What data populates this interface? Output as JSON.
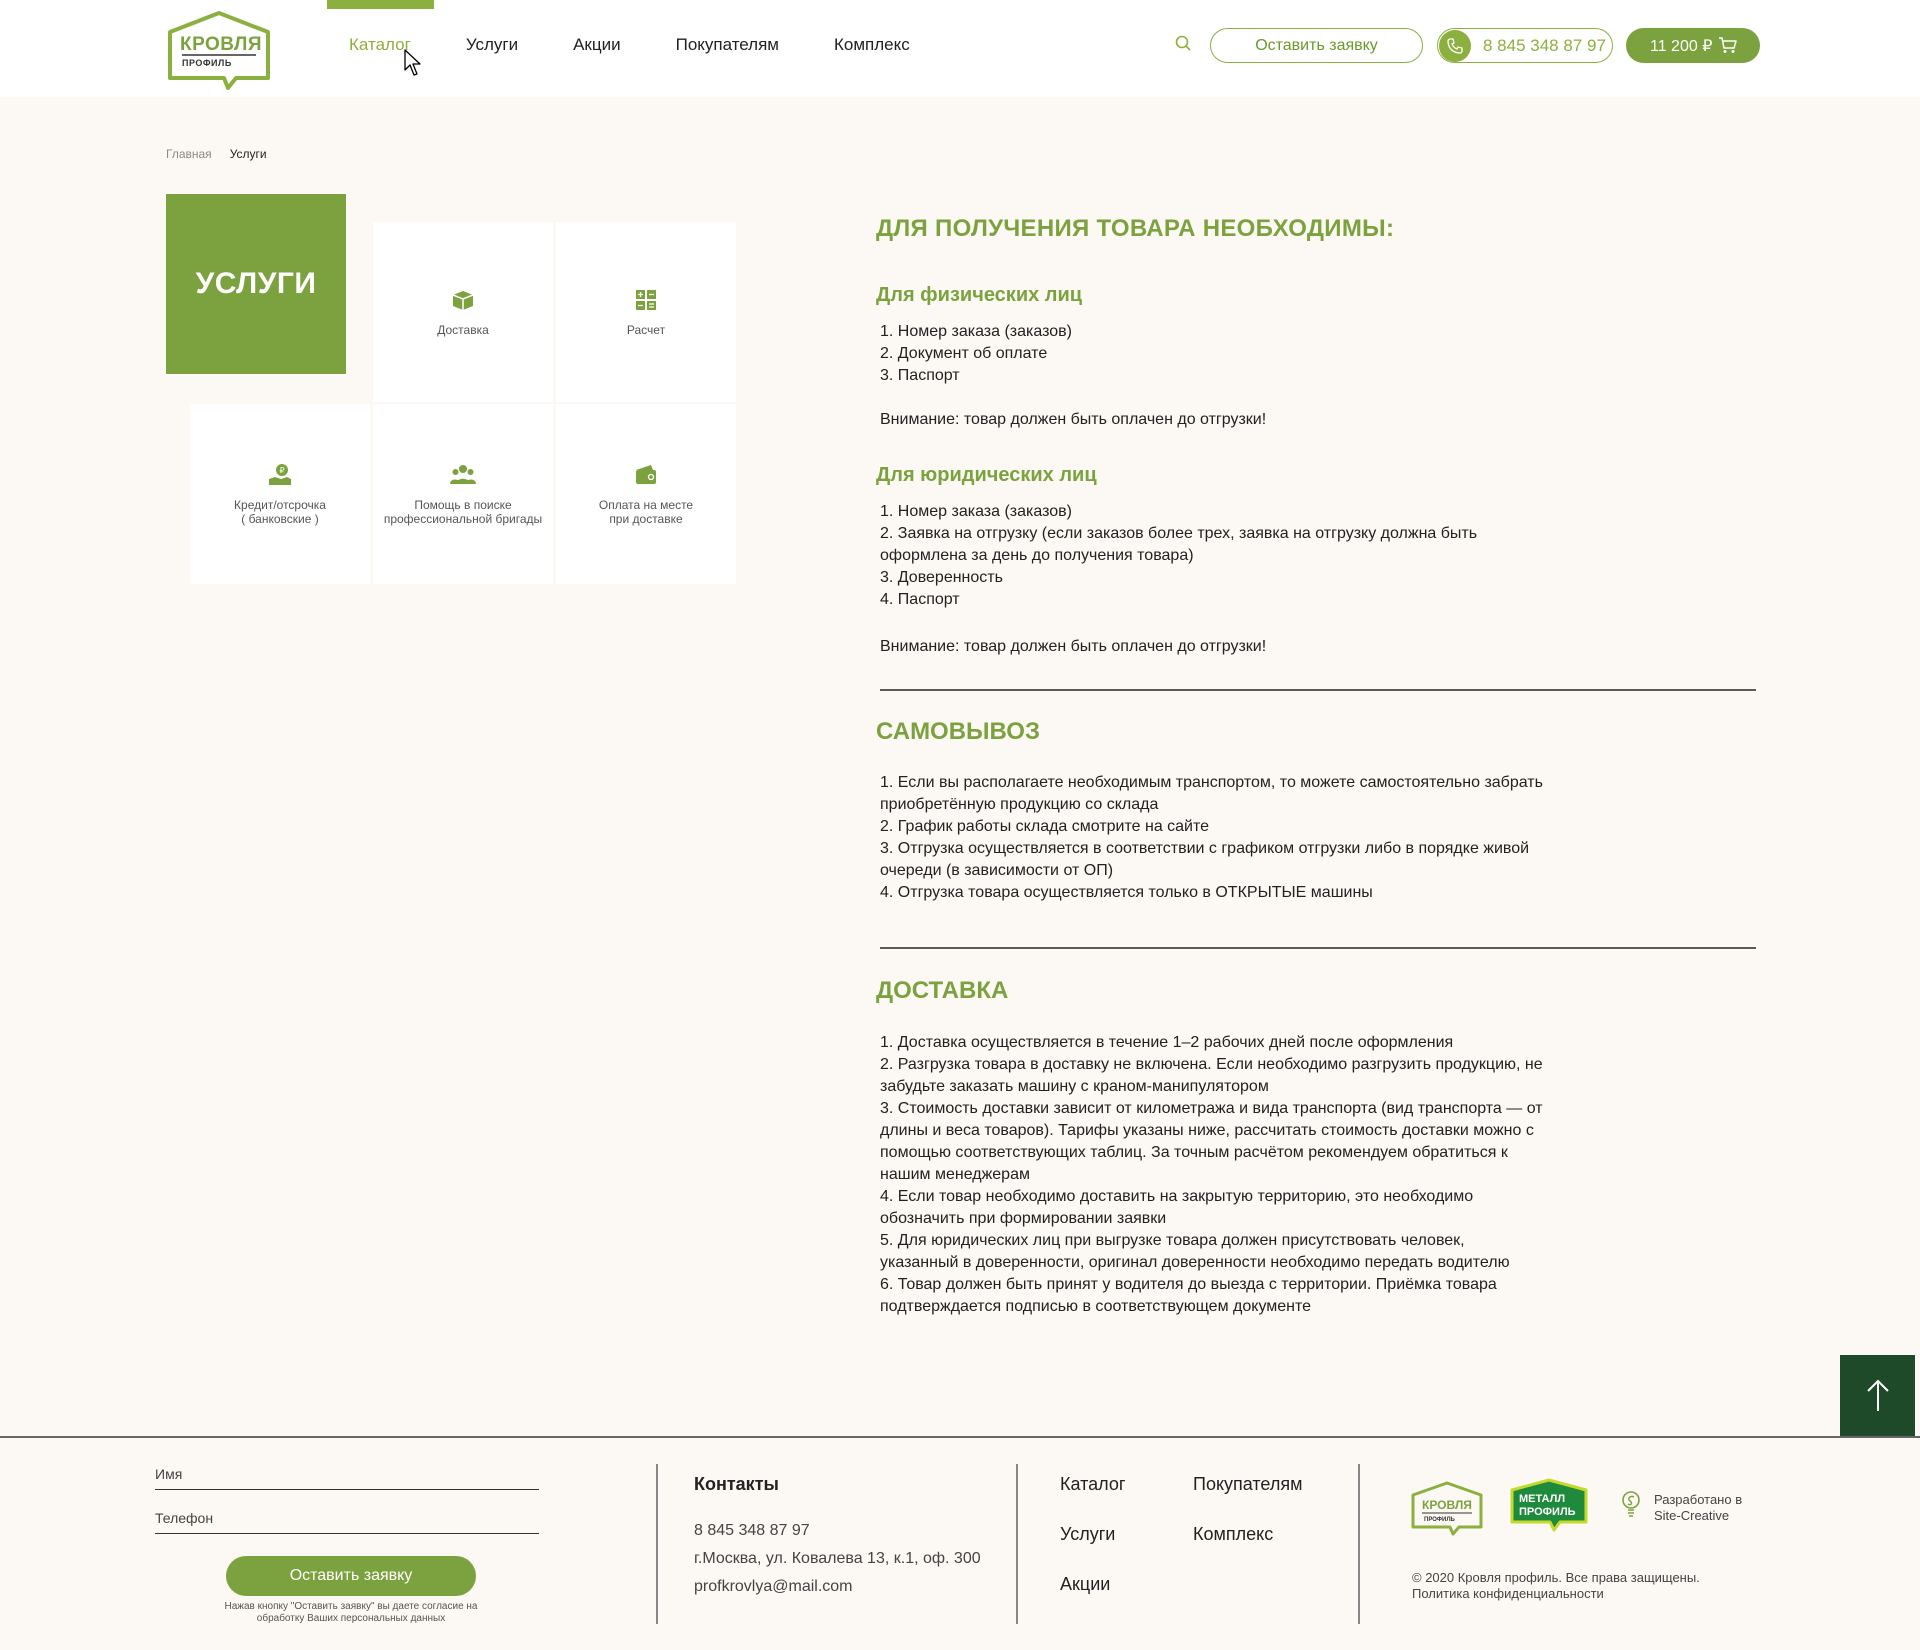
{
  "header": {
    "logo": {
      "line1": "КРОВЛЯ",
      "line2": "ПРОФИЛЬ"
    },
    "nav": [
      "Каталог",
      "Услуги",
      "Акции",
      "Покупателям",
      "Комплекс"
    ],
    "request_button": "Оставить заявку",
    "phone": "8 845 348 87 97",
    "cart_total": "11 200 ₽",
    "accent_color": "#8cb03f"
  },
  "breadcrumb": {
    "home": "Главная",
    "current": "Услуги"
  },
  "services": {
    "title": "УСЛУГИ",
    "tiles": [
      {
        "label": "Доставка",
        "icon": "box-icon"
      },
      {
        "label": "Расчет",
        "icon": "calculator-icon"
      },
      {
        "label": "Кредит/отсрочка\n( банковские )",
        "icon": "credit-icon"
      },
      {
        "label": "Помощь в поиске\nпрофессиональной бригады",
        "icon": "team-icon"
      },
      {
        "label": "Оплата на месте\nпри доставке",
        "icon": "wallet-icon"
      }
    ]
  },
  "content": {
    "heading": "ДЛЯ ПОЛУЧЕНИЯ ТОВАРА НЕОБХОДИМЫ:",
    "individuals_title": "Для физических лиц",
    "individuals_list": "1. Номер заказа (заказов)\n2. Документ об оплате\n3. Паспорт",
    "individuals_note": "Внимание: товар должен быть оплачен до отгрузки!",
    "legal_title": "Для юридических лиц",
    "legal_list": "1. Номер заказа (заказов)\n2. Заявка на отгрузку (если заказов более трех, заявка на отгрузку должна быть\nоформлена за день до получения товара)\n3. Доверенность\n4. Паспорт",
    "legal_note": "Внимание: товар должен быть оплачен до отгрузки!",
    "pickup_title": "САМОВЫВОЗ",
    "pickup_list": "1. Если вы располагаете необходимым транспортом, то можете самостоятельно забрать\nприобретённую продукцию со склада\n2. График работы склада смотрите на сайте\n3. Отгрузка осуществляется в соответствии с графиком отгрузки либо в порядке живой\nочереди (в зависимости от ОП)\n4. Отгрузка товара осуществляется только в ОТКРЫТЫЕ машины",
    "delivery_title": "ДОСТАВКА",
    "delivery_list": "1. Доставка осуществляется в течение 1–2 рабочих дней после оформления\n2. Разгрузка товара в доставку не включена. Если необходимо разгрузить продукцию, не\nзабудьте заказать машину с краном-манипулятором\n3. Стоимость доставки зависит от километража и вида транспорта (вид транспорта — от\nдлины и веса товаров). Тарифы указаны ниже, рассчитать стоимость доставки можно с\nпомощью соответствующих таблиц. За точным расчётом рекомендуем обратиться к\nнашим менеджерам\n4. Если товар необходимо доставить на закрытую территорию, это необходимо\nобозначить при формировании заявки\n5. Для юридических лиц при выгрузке товара должен присутствовать человек,\nуказанный в доверенности, оригинал доверенности необходимо передать водителю\n6. Товар должен быть принят у водителя до выезда с территории. Приёмка товара\nподтверждается подписью в соответствующем документе"
  },
  "footer": {
    "name_placeholder": "Имя",
    "phone_placeholder": "Телефон",
    "submit": "Оставить заявку",
    "consent": "Нажав кнопку \"Оставить заявку\" вы даете согласие на обработку Ваших персональных данных",
    "contacts_title": "Контакты",
    "phone": "8 845 348 87 97",
    "address": "г.Москва, ул. Ковалева 13, к.1, оф. 300",
    "email": "profkrovlya@mail.com",
    "links": [
      "Каталог",
      "Услуги",
      "Акции",
      "Покупателям",
      "Комплекс"
    ],
    "logo1": {
      "line1": "КРОВЛЯ",
      "line2": "ПРОФИЛЬ"
    },
    "logo2": {
      "line1": "МЕТАЛЛ",
      "line2": "ПРОФИЛЬ"
    },
    "developer": "Разработано в\nSite-Creative",
    "copyright": "© 2020 Кровля профиль. Все права защищены.",
    "privacy": "Политика конфиденциальности"
  }
}
